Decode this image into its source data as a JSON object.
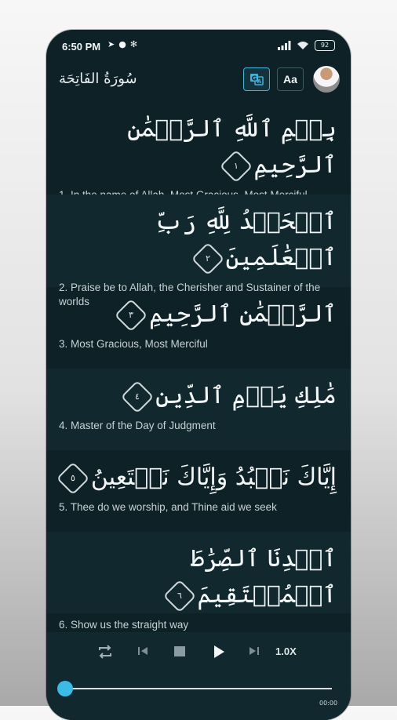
{
  "status_bar": {
    "time": "6:50 PM",
    "battery": "92"
  },
  "header": {
    "surah_title": "سُورَةُ الفَاتِحَة",
    "font_button": "Aa",
    "translate_icon": "translate-icon"
  },
  "verses": [
    {
      "number": "١",
      "arabic": "بِسۡمِ ٱللَّهِ ٱلرَّحۡمَٰنِ ٱلرَّحِيمِ",
      "translation": "1. In the name of Allah, Most Gracious, Most Merciful"
    },
    {
      "number": "٢",
      "arabic": "ٱلۡحَمۡدُ لِلَّهِ رَبِّ ٱلۡعَٰلَمِينَ",
      "translation": "2. Praise be to Allah, the Cherisher and Sustainer of the worlds"
    },
    {
      "number": "٣",
      "arabic": "ٱلرَّحۡمَٰنِ ٱلرَّحِيمِ",
      "translation": "3. Most Gracious, Most Merciful"
    },
    {
      "number": "٤",
      "arabic": "مَٰلِكِ يَوۡمِ ٱلدِّينِ",
      "translation": "4. Master of the Day of Judgment"
    },
    {
      "number": "٥",
      "arabic": "إِيَّاكَ نَعۡبُدُ وَإِيَّاكَ نَسۡتَعِينُ",
      "translation": "5. Thee do we worship, and Thine aid we seek"
    },
    {
      "number": "٦",
      "arabic": "ٱهۡدِنَا ٱلصِّرَٰطَ ٱلۡمُسۡتَقِيمَ",
      "translation": "6. Show us the straight way"
    }
  ],
  "player": {
    "speed": "1.0X",
    "elapsed": "00:00",
    "progress": 0.0
  }
}
